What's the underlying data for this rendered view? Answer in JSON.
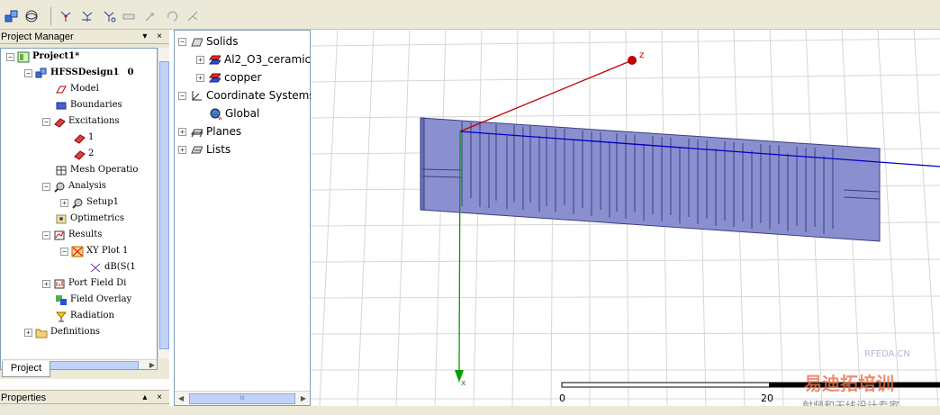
{
  "toolbar": {
    "icons": [
      "boxes-icon",
      "sphere-icon",
      "measure-position-icon",
      "measure-distance-icon",
      "measure-length-icon",
      "ruler-icon",
      "arrow-move-icon",
      "rotate-icon",
      "coords-icon"
    ]
  },
  "project_manager": {
    "title": "Project Manager",
    "controls": "▾ ×",
    "tab_label": "Project",
    "tree": {
      "project": "Project1*",
      "design": "HFSSDesign1",
      "design_suffix": "0",
      "model": "Model",
      "boundaries": "Boundaries",
      "excitations": "Excitations",
      "excitation_1": "1",
      "excitation_2": "2",
      "mesh": "Mesh Operatio",
      "analysis": "Analysis",
      "setup": "Setup1",
      "optimetrics": "Optimetrics",
      "results": "Results",
      "xy_plot": "XY Plot 1",
      "db_trace": "dB(S(1",
      "port_field": "Port Field Di",
      "field_overlay": "Field Overlay",
      "radiation": "Radiation",
      "definitions": "Definitions"
    }
  },
  "properties": {
    "title": "Properties",
    "controls": "▴ ×"
  },
  "model_tree": {
    "solids": "Solids",
    "material_1": "Al2_O3_ceramic",
    "material_2": "copper",
    "coordinate_systems": "Coordinate Systems",
    "global": "Global",
    "planes": "Planes",
    "lists": "Lists",
    "scroll_grip": "III"
  },
  "viewport": {
    "axis_z_label": "z",
    "axis_x_label": "x",
    "scale_start": "0",
    "scale_mid": "20",
    "watermark_site": "RFEDA.CN",
    "watermark_brand": "易迪拓培训",
    "watermark_tagline": "射频和天线设计专家",
    "colors": {
      "solid": "#8a8fd0",
      "solid_edge": "#3c3f80",
      "axis_x": "#0000c0",
      "axis_y": "#00a000",
      "axis_z": "#c00000",
      "grid": "#d6d6d6"
    }
  }
}
